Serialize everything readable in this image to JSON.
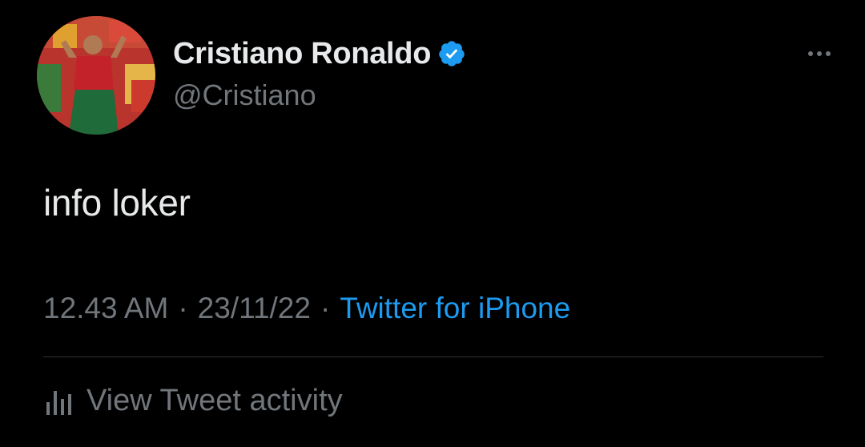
{
  "author": {
    "display_name": "Cristiano Ronaldo",
    "handle": "@Cristiano",
    "verified_color": "#1d9bf0"
  },
  "tweet": {
    "text": "info loker"
  },
  "meta": {
    "time": "12.43 AM",
    "separator": "·",
    "date": "23/11/22",
    "source": "Twitter for iPhone"
  },
  "activity": {
    "label": "View Tweet activity"
  },
  "colors": {
    "background": "#000000",
    "primary_text": "#e7e9ea",
    "secondary_text": "#71767b",
    "accent": "#1d9bf0",
    "divider": "#2f3336"
  },
  "icons": {
    "verified": "verified-badge-icon",
    "more": "more-options-icon",
    "activity": "bar-chart-icon"
  }
}
